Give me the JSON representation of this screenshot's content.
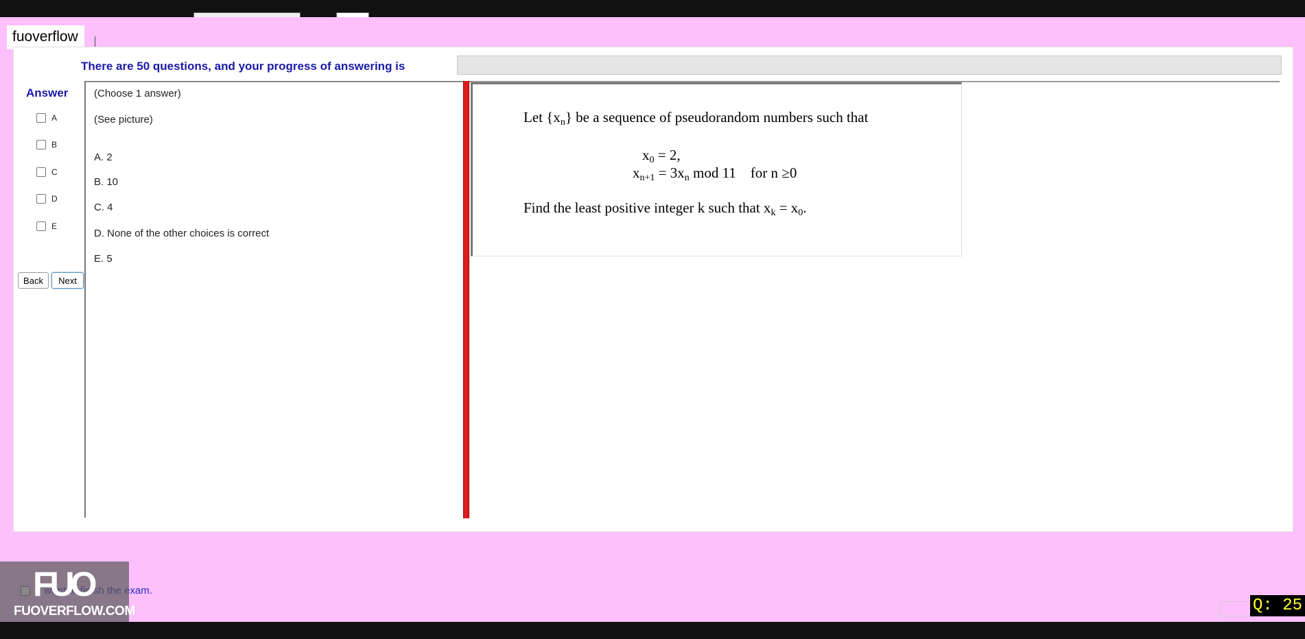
{
  "header": {
    "timer_fragment": ""
  },
  "brand": {
    "label": "fuoverflow"
  },
  "progress": {
    "label": "There are 50 questions, and your progress of answering is",
    "value": 0
  },
  "answer": {
    "title": "Answer",
    "options": [
      "A",
      "B",
      "C",
      "D",
      "E"
    ]
  },
  "nav": {
    "back_label": "Back",
    "next_label": "Next"
  },
  "choices": {
    "instruction": "(Choose 1 answer)",
    "see_picture": "(See picture)",
    "items": [
      "A.  2",
      "B.  10",
      "C.  4",
      "D.  None of the other choices is correct",
      "E.  5"
    ]
  },
  "question": {
    "intro_pre": "Let {x",
    "intro_sub": "n",
    "intro_post": "} be a sequence of pseudorandom numbers such that",
    "eq1_pre": "x",
    "eq1_sub": "0",
    "eq1_post": " = 2,",
    "eq2_pre": "x",
    "eq2_sub": "n+1",
    "eq2_mid": " = 3x",
    "eq2_sub2": "n",
    "eq2_post": " mod 11    for n ≥0",
    "find_pre": "Find the least positive integer k such that x",
    "find_sub": "k",
    "find_mid": " = x",
    "find_sub2": "0",
    "find_post": "."
  },
  "finish": {
    "label": "I want to finish the exam."
  },
  "watermark": {
    "mark": "FUO",
    "site": "FUOVERFLOW.COM"
  },
  "counter": {
    "label": "Q: 25"
  }
}
